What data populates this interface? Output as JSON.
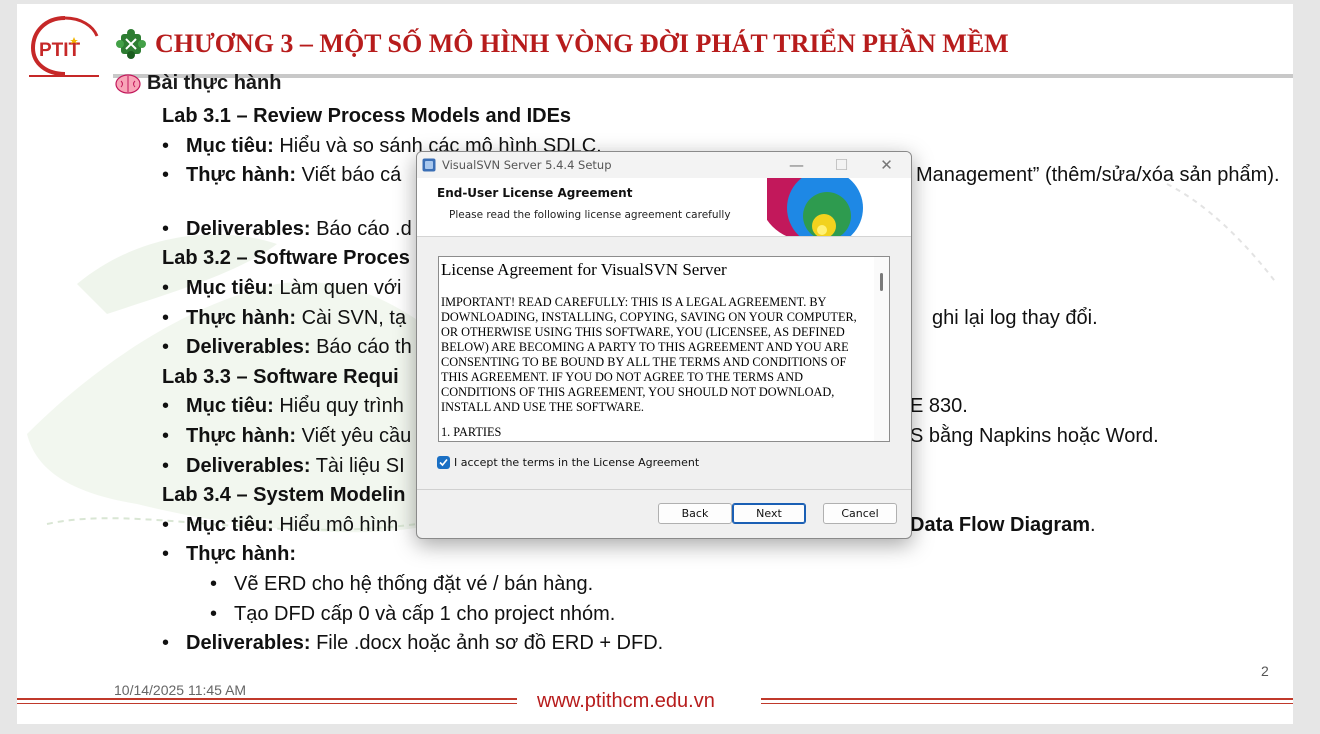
{
  "slide": {
    "logo_text": "PTIT",
    "title": "CHƯƠNG 3 – MỘT SỐ MÔ HÌNH VÒNG ĐỜI PHÁT TRIỂN PHẦN MỀM",
    "section": "Bài thực hành",
    "labs": [
      {
        "heading": "Lab 3.1 – Review Process Models and IDEs",
        "goal_label": "Mục tiêu:",
        "goal": " Hiểu và so sánh các mô hình SDLC.",
        "practice_label": "Thực hành:",
        "practice": " Viết báo cá",
        "practice_tail": "Management” (thêm/sửa/xóa sản phẩm).",
        "deliverables_label": "Deliverables:",
        "deliverables": " Báo cáo .d"
      },
      {
        "heading": "Lab 3.2 – Software Proces",
        "goal_label": "Mục tiêu:",
        "goal": " Làm quen với",
        "practice_label": "Thực hành:",
        "practice": " Cài SVN, tạ",
        "practice_tail": "ghi lại log thay đổi.",
        "deliverables_label": "Deliverables:",
        "deliverables": " Báo cáo th"
      },
      {
        "heading": "Lab 3.3 – Software Requi",
        "goal_label": "Mục tiêu:",
        "goal": " Hiểu quy trình",
        "goal_tail": "E 830.",
        "practice_label": "Thực hành:",
        "practice": " Viết yêu cầu",
        "practice_tail": "S bằng Napkins hoặc Word.",
        "deliverables_label": "Deliverables:",
        "deliverables": " Tài liệu SI"
      },
      {
        "heading": "Lab 3.4 – System Modelin",
        "goal_label": "Mục tiêu:",
        "goal": " Hiểu mô hình",
        "goal_tail_bold": "Data Flow Diagram",
        "goal_tail_end": ".",
        "practice_label": "Thực hành:",
        "sub_items": [
          "Vẽ ERD cho hệ thống đặt vé / bán hàng.",
          "Tạo DFD cấp 0 và cấp 1 cho project nhóm."
        ],
        "deliverables_label": "Deliverables:",
        "deliverables": " File .docx hoặc ảnh sơ đồ ERD + DFD."
      }
    ],
    "page_number": "2",
    "date": "10/14/2025 11:45 AM",
    "footer_url": "www.ptithcm.edu.vn"
  },
  "dialog": {
    "window_title": "VisualSVN Server 5.4.4 Setup",
    "header_title": "End-User License Agreement",
    "header_subtitle": "Please read the following license agreement carefully",
    "license_title": "License Agreement for VisualSVN Server",
    "license_body": "IMPORTANT! READ CAREFULLY: THIS IS A LEGAL AGREEMENT. BY DOWNLOADING, INSTALLING, COPYING, SAVING ON YOUR COMPUTER, OR OTHERWISE USING THIS SOFTWARE, YOU (LICENSEE, AS DEFINED BELOW) ARE BECOMING A PARTY TO THIS AGREEMENT AND YOU ARE CONSENTING TO BE BOUND BY ALL THE TERMS AND CONDITIONS OF THIS AGREEMENT. IF YOU DO NOT AGREE TO THE TERMS AND CONDITIONS OF THIS AGREEMENT, YOU SHOULD NOT DOWNLOAD, INSTALL AND USE THE SOFTWARE.",
    "license_more": "1. PARTIES",
    "accept_label": "I accept the terms in the License Agreement",
    "accept_checked": true,
    "buttons": {
      "back": "Back",
      "next": "Next",
      "cancel": "Cancel"
    },
    "window_controls": {
      "minimize": "minimize-icon",
      "maximize": "maximize-icon",
      "close": "close-icon"
    }
  },
  "colors": {
    "title_red": "#b71c1c",
    "accent_blue": "#1a6fc4",
    "footer_red": "#c0392b"
  }
}
